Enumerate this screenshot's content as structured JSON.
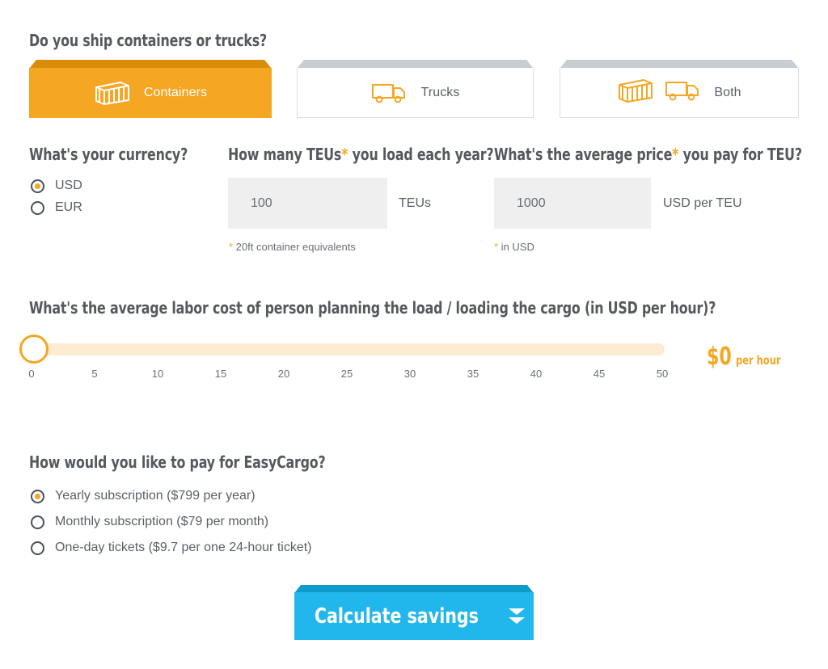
{
  "shipping_question": {
    "heading": "Do you ship containers or trucks?",
    "tabs": [
      {
        "label": "Containers",
        "icons": [
          "container-icon"
        ],
        "selected": true
      },
      {
        "label": "Trucks",
        "icons": [
          "truck-icon"
        ],
        "selected": false
      },
      {
        "label": "Both",
        "icons": [
          "container-icon",
          "plus-sign",
          "truck-icon"
        ],
        "selected": false
      }
    ]
  },
  "currency": {
    "heading": "What's your currency?",
    "options": [
      {
        "label": "USD",
        "selected": true
      },
      {
        "label": "EUR",
        "selected": false
      }
    ]
  },
  "teus": {
    "heading_before": "How many TEUs",
    "heading_star": "*",
    "heading_after": " you load each year?",
    "value": "100",
    "unit": "TEUs",
    "note_star": "*",
    "note": " 20ft container equivalents"
  },
  "price": {
    "heading_before": "What's the average price",
    "heading_star": "*",
    "heading_after": " you pay for TEU?",
    "value": "1000",
    "unit": "USD per TEU",
    "note_star": "*",
    "note": " in USD"
  },
  "labor": {
    "heading": "What's the average labor cost of person planning the load / loading the cargo (in USD per hour)?",
    "slider": {
      "min": 0,
      "max": 50,
      "value": 0,
      "ticks": [
        "0",
        "5",
        "10",
        "15",
        "20",
        "25",
        "30",
        "35",
        "40",
        "45",
        "50"
      ]
    },
    "value_amount": "$0",
    "value_unit": "per hour"
  },
  "payment": {
    "heading": "How would you like to pay for EasyCargo?",
    "options": [
      {
        "label": "Yearly subscription ($799 per year)",
        "selected": true
      },
      {
        "label": "Monthly subscription ($79 per month)",
        "selected": false
      },
      {
        "label": "One-day tickets ($9.7 per one 24-hour ticket)",
        "selected": false
      }
    ]
  },
  "submit": {
    "label": "Calculate savings",
    "icon": "double-chevron-down-icon"
  },
  "colors": {
    "orange": "#f5a623",
    "orange_dark": "#d98b0a",
    "track": "#fdebd2",
    "blue": "#22b7ec",
    "blue_dark": "#0d9cc9",
    "text": "#5b6066",
    "field_bg": "#efefef"
  }
}
